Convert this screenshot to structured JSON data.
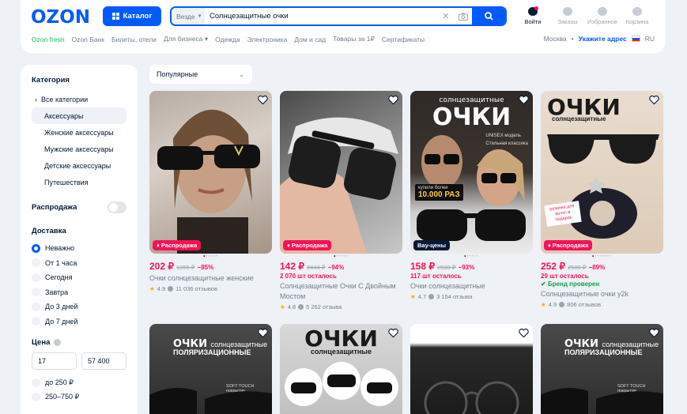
{
  "header": {
    "logo": "OZON",
    "catalog_label": "Каталог",
    "search_scope": "Везде",
    "search_query": "Солнцезащитные очки",
    "actions": [
      {
        "label": "Войти"
      },
      {
        "label": "Заказы"
      },
      {
        "label": "Избранное"
      },
      {
        "label": "Корзина"
      }
    ]
  },
  "subnav": {
    "links": [
      "Ozon fresh",
      "Ozon Банк",
      "Билеты, отели",
      "Для бизнеса",
      "Одежда",
      "Электроника",
      "Дом и сад",
      "Товары за 1₽",
      "Сертификаты"
    ],
    "city": "Москва",
    "address_link": "Укажите адрес",
    "lang": "RU"
  },
  "sidebar": {
    "category_heading": "Категория",
    "categories": [
      "Все категории",
      "Аксессуары",
      "Женские аксессуары",
      "Мужские аксессуары",
      "Детские аксессуары",
      "Путешествия"
    ],
    "sale_label": "Распродажа",
    "delivery_heading": "Доставка",
    "delivery_options": [
      "Неважно",
      "От 1 часа",
      "Сегодня",
      "Завтра",
      "До 3 дней",
      "До 7 дней"
    ],
    "price_heading": "Цена",
    "price_from": "17",
    "price_to": "57 400",
    "price_ranges": [
      "до 250 ₽",
      "250–750 ₽"
    ]
  },
  "sort": {
    "selected": "Популярные"
  },
  "products": [
    {
      "badge": "Распродажа",
      "price": "202 ₽",
      "old_price": "1355 ₽",
      "discount": "−85%",
      "note": "",
      "title": "Очки солнцезащитные женские",
      "rating": "4.9",
      "reviews": "11 036 отзывов"
    },
    {
      "badge": "Распродажа",
      "price": "142 ₽",
      "old_price": "2444 ₽",
      "discount": "−94%",
      "note": "2 070 шт осталось",
      "title": "Солнцезащитные Очки С Двойным Мостом",
      "rating": "4.8",
      "reviews": "5 262 отзыва"
    },
    {
      "badge": "Вау-цены",
      "price": "158 ₽",
      "old_price": "2500 ₽",
      "discount": "−93%",
      "note": "117 шт осталось",
      "title": "Очки солнцезащитные",
      "rating": "4.7",
      "reviews": "3 154 отзыва",
      "img_title": "солнцезащитные",
      "img_big": "ОЧКИ",
      "img_tags": [
        "UNISEX модель",
        "Стильная классика"
      ],
      "img_promo_top": "купили более",
      "img_promo_val": "10.000 РАЗ"
    },
    {
      "badge": "Распродажа",
      "price": "252 ₽",
      "old_price": "2500 ₽",
      "discount": "−89%",
      "note": "29 шт осталось",
      "note2": "Бренд проверен",
      "title": "Солнцезащитные очки y2k",
      "rating": "4.9",
      "reviews": "806 отзывов",
      "img_big": "ОЧКИ",
      "img_title": "солнцезащитные",
      "img_note": "резинка для волос в подарок"
    }
  ],
  "row2": [
    {
      "img_big": "ОЧКИ",
      "img_title": "солнцезащитные",
      "img_sub": "ПОЛЯРИЗАЦИОННЫЕ",
      "img_note": "SOFT TOUCH покрытие"
    },
    {
      "img_big": "ОЧКИ",
      "img_title": "солнцезащитные"
    },
    {},
    {
      "img_big": "ОЧКИ",
      "img_title": "солнцезащитные",
      "img_sub": "ПОЛЯРИЗАЦИОННЫЕ",
      "img_note": "SOFT TOUCH покрытие"
    }
  ]
}
